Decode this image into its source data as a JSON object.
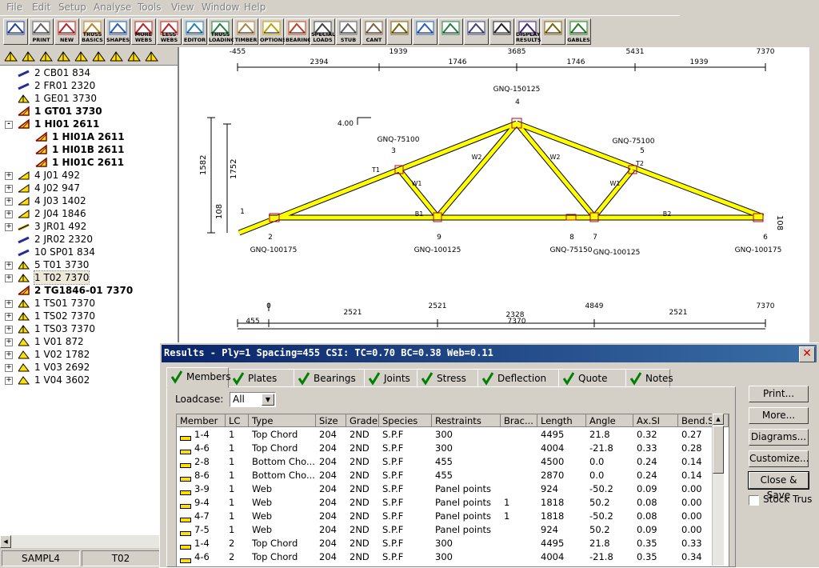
{
  "menu": [
    "File",
    "Edit",
    "Setup",
    "Analyse",
    "Tools",
    "View",
    "Window",
    "Help"
  ],
  "toolbar": [
    {
      "label": "",
      "icon": "save-icon"
    },
    {
      "label": "PRINT",
      "icon": "print-icon"
    },
    {
      "label": "NEW",
      "icon": "new-truss-icon"
    },
    {
      "label": "TRUSS\nBASICS",
      "icon": "truss-basics-icon"
    },
    {
      "label": "SHAPES",
      "icon": "shapes-icon"
    },
    {
      "label": "MORE\nWEBS",
      "icon": "more-webs-icon"
    },
    {
      "label": "LESS\nWEBS",
      "icon": "less-webs-icon"
    },
    {
      "label": "EDITOR",
      "icon": "editor-icon"
    },
    {
      "label": "TRUSS\nLOADING",
      "icon": "truss-loading-icon"
    },
    {
      "label": "TIMBER",
      "icon": "timber-icon"
    },
    {
      "label": "OPTIONS",
      "icon": "options-icon"
    },
    {
      "label": "BEARING",
      "icon": "bearing-icon"
    },
    {
      "label": "SPECIAL\nLOADS",
      "icon": "special-loads-icon"
    },
    {
      "label": "STUB",
      "icon": "stub-icon"
    },
    {
      "label": "CANT",
      "icon": "cant-icon"
    },
    {
      "label": "",
      "icon": "splice-icon"
    },
    {
      "label": "",
      "icon": "pitch-icon"
    },
    {
      "label": "",
      "icon": "heel-icon"
    },
    {
      "label": "",
      "icon": "grid-icon"
    },
    {
      "label": "",
      "icon": "traffic-light-icon"
    },
    {
      "label": "DISPLAY\nRESULTS",
      "icon": "display-results-icon"
    },
    {
      "label": "",
      "icon": "bracing-icon"
    },
    {
      "label": "GABLES",
      "icon": "gables-icon"
    }
  ],
  "tree": [
    {
      "text": "2 CB01 834",
      "bold": false,
      "icon": "chord-icon",
      "indent": 0,
      "exp": ""
    },
    {
      "text": "2 FR01 2320",
      "bold": false,
      "icon": "chord-icon",
      "indent": 0,
      "exp": ""
    },
    {
      "text": "1 GE01 3730",
      "bold": false,
      "icon": "truss-icon",
      "indent": 0,
      "exp": ""
    },
    {
      "text": "1 GT01 3730",
      "bold": true,
      "icon": "girder-truss-icon",
      "indent": 0,
      "exp": ""
    },
    {
      "text": "1 HI01 2611",
      "bold": true,
      "icon": "hip-truss-icon",
      "indent": 0,
      "exp": "-"
    },
    {
      "text": "1 HI01A 2611",
      "bold": true,
      "icon": "hip-truss-icon",
      "indent": 1,
      "exp": ""
    },
    {
      "text": "1 HI01B 2611",
      "bold": true,
      "icon": "hip-truss-icon",
      "indent": 1,
      "exp": ""
    },
    {
      "text": "1 HI01C 2611",
      "bold": true,
      "icon": "hip-truss-icon",
      "indent": 1,
      "exp": ""
    },
    {
      "text": "4 J01 492",
      "bold": false,
      "icon": "jack-icon",
      "indent": 0,
      "exp": "+"
    },
    {
      "text": "4 J02 947",
      "bold": false,
      "icon": "jack-icon",
      "indent": 0,
      "exp": "+"
    },
    {
      "text": "4 J03 1402",
      "bold": false,
      "icon": "jack-icon",
      "indent": 0,
      "exp": "+"
    },
    {
      "text": "2 J04 1846",
      "bold": false,
      "icon": "jack-icon",
      "indent": 0,
      "exp": "+"
    },
    {
      "text": "3 JR01 492",
      "bold": false,
      "icon": "rafter-icon",
      "indent": 0,
      "exp": "+"
    },
    {
      "text": "2 JR02 2320",
      "bold": false,
      "icon": "chord-icon",
      "indent": 0,
      "exp": ""
    },
    {
      "text": "10 SP01 834",
      "bold": false,
      "icon": "chord-icon",
      "indent": 0,
      "exp": ""
    },
    {
      "text": "5 T01 3730",
      "bold": false,
      "icon": "truss-icon",
      "indent": 0,
      "exp": "+"
    },
    {
      "text": "1 T02 7370",
      "bold": false,
      "icon": "truss-icon",
      "indent": 0,
      "exp": "+",
      "selected": true
    },
    {
      "text": "2 TG1846-01 7370",
      "bold": true,
      "icon": "girder-truss-icon",
      "indent": 0,
      "exp": ""
    },
    {
      "text": "1 TS01 7370",
      "bold": false,
      "icon": "truss-icon",
      "indent": 0,
      "exp": "+"
    },
    {
      "text": "1 TS02 7370",
      "bold": false,
      "icon": "truss-icon",
      "indent": 0,
      "exp": "+"
    },
    {
      "text": "1 TS03 7370",
      "bold": false,
      "icon": "truss-icon",
      "indent": 0,
      "exp": "+"
    },
    {
      "text": "1 V01 872",
      "bold": false,
      "icon": "valley-truss-icon",
      "indent": 0,
      "exp": "+"
    },
    {
      "text": "1 V02 1782",
      "bold": false,
      "icon": "valley-truss-icon",
      "indent": 0,
      "exp": "+"
    },
    {
      "text": "1 V03 2692",
      "bold": false,
      "icon": "valley-truss-icon",
      "indent": 0,
      "exp": "+"
    },
    {
      "text": "1 V04 3602",
      "bold": false,
      "icon": "valley-truss-icon",
      "indent": 0,
      "exp": "+"
    }
  ],
  "status": {
    "job": "SAMPL4",
    "truss": "T02"
  },
  "drawing": {
    "top_dim_labels": [
      "-455",
      "1939",
      "3685",
      "5431",
      "7370"
    ],
    "top_seg_labels": [
      "2394",
      "1746",
      "1746",
      "1939"
    ],
    "bottom_dim_labels": [
      "0",
      "2521",
      "4849",
      "7370"
    ],
    "bottom_seg_labels": [
      "2521",
      "2328",
      "2521"
    ],
    "overall_label": "7370",
    "overhang_label": "455",
    "pitch": "4.00",
    "height_outer": "1582",
    "height_inner": "1752",
    "heel_left": "108",
    "heel_right": "108",
    "plates": [
      "GNQ-150125",
      "GNQ-75100",
      "GNQ-75100",
      "GNQ-100175",
      "GNQ-100125",
      "GNQ-75150",
      "GNQ-100125",
      "GNQ-100175"
    ],
    "joints": [
      "1",
      "2",
      "3",
      "4",
      "5",
      "6",
      "7",
      "8",
      "9"
    ],
    "members": [
      "T1",
      "T2",
      "W1",
      "W2",
      "W2",
      "W1",
      "B1",
      "B2"
    ]
  },
  "dialog": {
    "title": "Results - Ply=1 Spacing=455 CSI: TC=0.70 BC=0.38 Web=0.11",
    "tabs": [
      "Members",
      "Plates",
      "Bearings",
      "Joints",
      "Stress",
      "Deflection",
      "Quote",
      "Notes"
    ],
    "loadcase_label": "Loadcase:",
    "loadcase_value": "All",
    "buttons": [
      "Print...",
      "More...",
      "Diagrams...",
      "Customize...",
      "Close & Save"
    ],
    "stock_label": "Stock Trus",
    "columns": [
      "Member",
      "LC",
      "Type",
      "Size",
      "Grade",
      "Species",
      "Restraints",
      "Brac...",
      "Length",
      "Angle",
      "Ax.SI",
      "Bend.SI"
    ],
    "rows": [
      [
        "1-4",
        "1",
        "Top Chord",
        "204",
        "2ND",
        "S.P.F",
        "300",
        "",
        "4495",
        "21.8",
        "0.32",
        "0.27"
      ],
      [
        "4-6",
        "1",
        "Top Chord",
        "204",
        "2ND",
        "S.P.F",
        "300",
        "",
        "4004",
        "-21.8",
        "0.33",
        "0.28"
      ],
      [
        "2-8",
        "1",
        "Bottom Cho...",
        "204",
        "2ND",
        "S.P.F",
        "455",
        "",
        "4500",
        "0.0",
        "0.24",
        "0.14"
      ],
      [
        "8-6",
        "1",
        "Bottom Cho...",
        "204",
        "2ND",
        "S.P.F",
        "455",
        "",
        "2870",
        "0.0",
        "0.24",
        "0.14"
      ],
      [
        "3-9",
        "1",
        "Web",
        "204",
        "2ND",
        "S.P.F",
        "Panel points",
        "",
        "924",
        "-50.2",
        "0.09",
        "0.00"
      ],
      [
        "9-4",
        "1",
        "Web",
        "204",
        "2ND",
        "S.P.F",
        "Panel points",
        "1",
        "1818",
        "50.2",
        "0.08",
        "0.00"
      ],
      [
        "4-7",
        "1",
        "Web",
        "204",
        "2ND",
        "S.P.F",
        "Panel points",
        "1",
        "1818",
        "-50.2",
        "0.08",
        "0.00"
      ],
      [
        "7-5",
        "1",
        "Web",
        "204",
        "2ND",
        "S.P.F",
        "Panel points",
        "",
        "924",
        "50.2",
        "0.09",
        "0.00"
      ],
      [
        "1-4",
        "2",
        "Top Chord",
        "204",
        "2ND",
        "S.P.F",
        "300",
        "",
        "4495",
        "21.8",
        "0.35",
        "0.33"
      ],
      [
        "4-6",
        "2",
        "Top Chord",
        "204",
        "2ND",
        "S.P.F",
        "300",
        "",
        "4004",
        "-21.8",
        "0.35",
        "0.34"
      ]
    ]
  }
}
